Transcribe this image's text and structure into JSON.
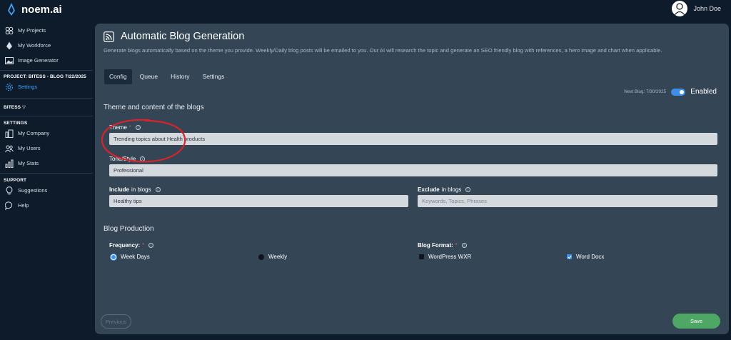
{
  "app": {
    "name": "noem.ai"
  },
  "user": {
    "name": "John Doe"
  },
  "sidebar": {
    "top_items": [
      {
        "label": "My Projects",
        "icon": "projects-icon"
      },
      {
        "label": "My Workforce",
        "icon": "workforce-icon"
      },
      {
        "label": "Image Generator",
        "icon": "image-icon"
      }
    ],
    "project_header": "PROJECT: BITESS - BLOG 7/22/2025",
    "project_settings": "Settings",
    "bitess_header": "BITESS",
    "settings_header": "SETTINGS",
    "settings_items": [
      {
        "label": "My Company",
        "icon": "company-icon"
      },
      {
        "label": "My Users",
        "icon": "users-icon"
      },
      {
        "label": "My Stats",
        "icon": "stats-icon"
      }
    ],
    "support_header": "SUPPORT",
    "support_items": [
      {
        "label": "Suggestions",
        "icon": "lightbulb-icon"
      },
      {
        "label": "Help",
        "icon": "chat-icon"
      }
    ]
  },
  "page": {
    "title": "Automatic Blog Generation",
    "description": "Generate blogs automatically based on the theme you provide. Weekly/Daily blog posts will be emailed to you. Our AI will research the topic and generate an SEO friendly blog with references, a hero image and chart when applicable.",
    "tabs": [
      "Config",
      "Queue",
      "History",
      "Settings"
    ],
    "next_blog": "Next Blog: 7/30/2025",
    "toggle_label": "Enabled"
  },
  "config": {
    "section_theme": "Theme and content of the blogs",
    "theme_label": "Theme",
    "theme_value": "Trending topics about Health products",
    "tone_label": "Tone/Style",
    "tone_value": "Professional",
    "include_bold": "Include",
    "include_rest": "in blogs",
    "include_value": "Healthy tips",
    "exclude_bold": "Exclude",
    "exclude_rest": "in blogs",
    "exclude_placeholder": "Keywords, Topics, Phrases",
    "section_production": "Blog Production",
    "frequency_label": "Frequency:",
    "frequency_options": [
      "Week Days",
      "Weekly"
    ],
    "format_label": "Blog Format:",
    "format_options": [
      "WordPress WXR",
      "Word Docx"
    ],
    "required_mark": "*",
    "info_mark": "i"
  },
  "buttons": {
    "previous": "Previous",
    "save": "Save"
  },
  "colors": {
    "accent": "#3d8fe9",
    "save": "#4ea765",
    "annotation": "#d8232a"
  }
}
